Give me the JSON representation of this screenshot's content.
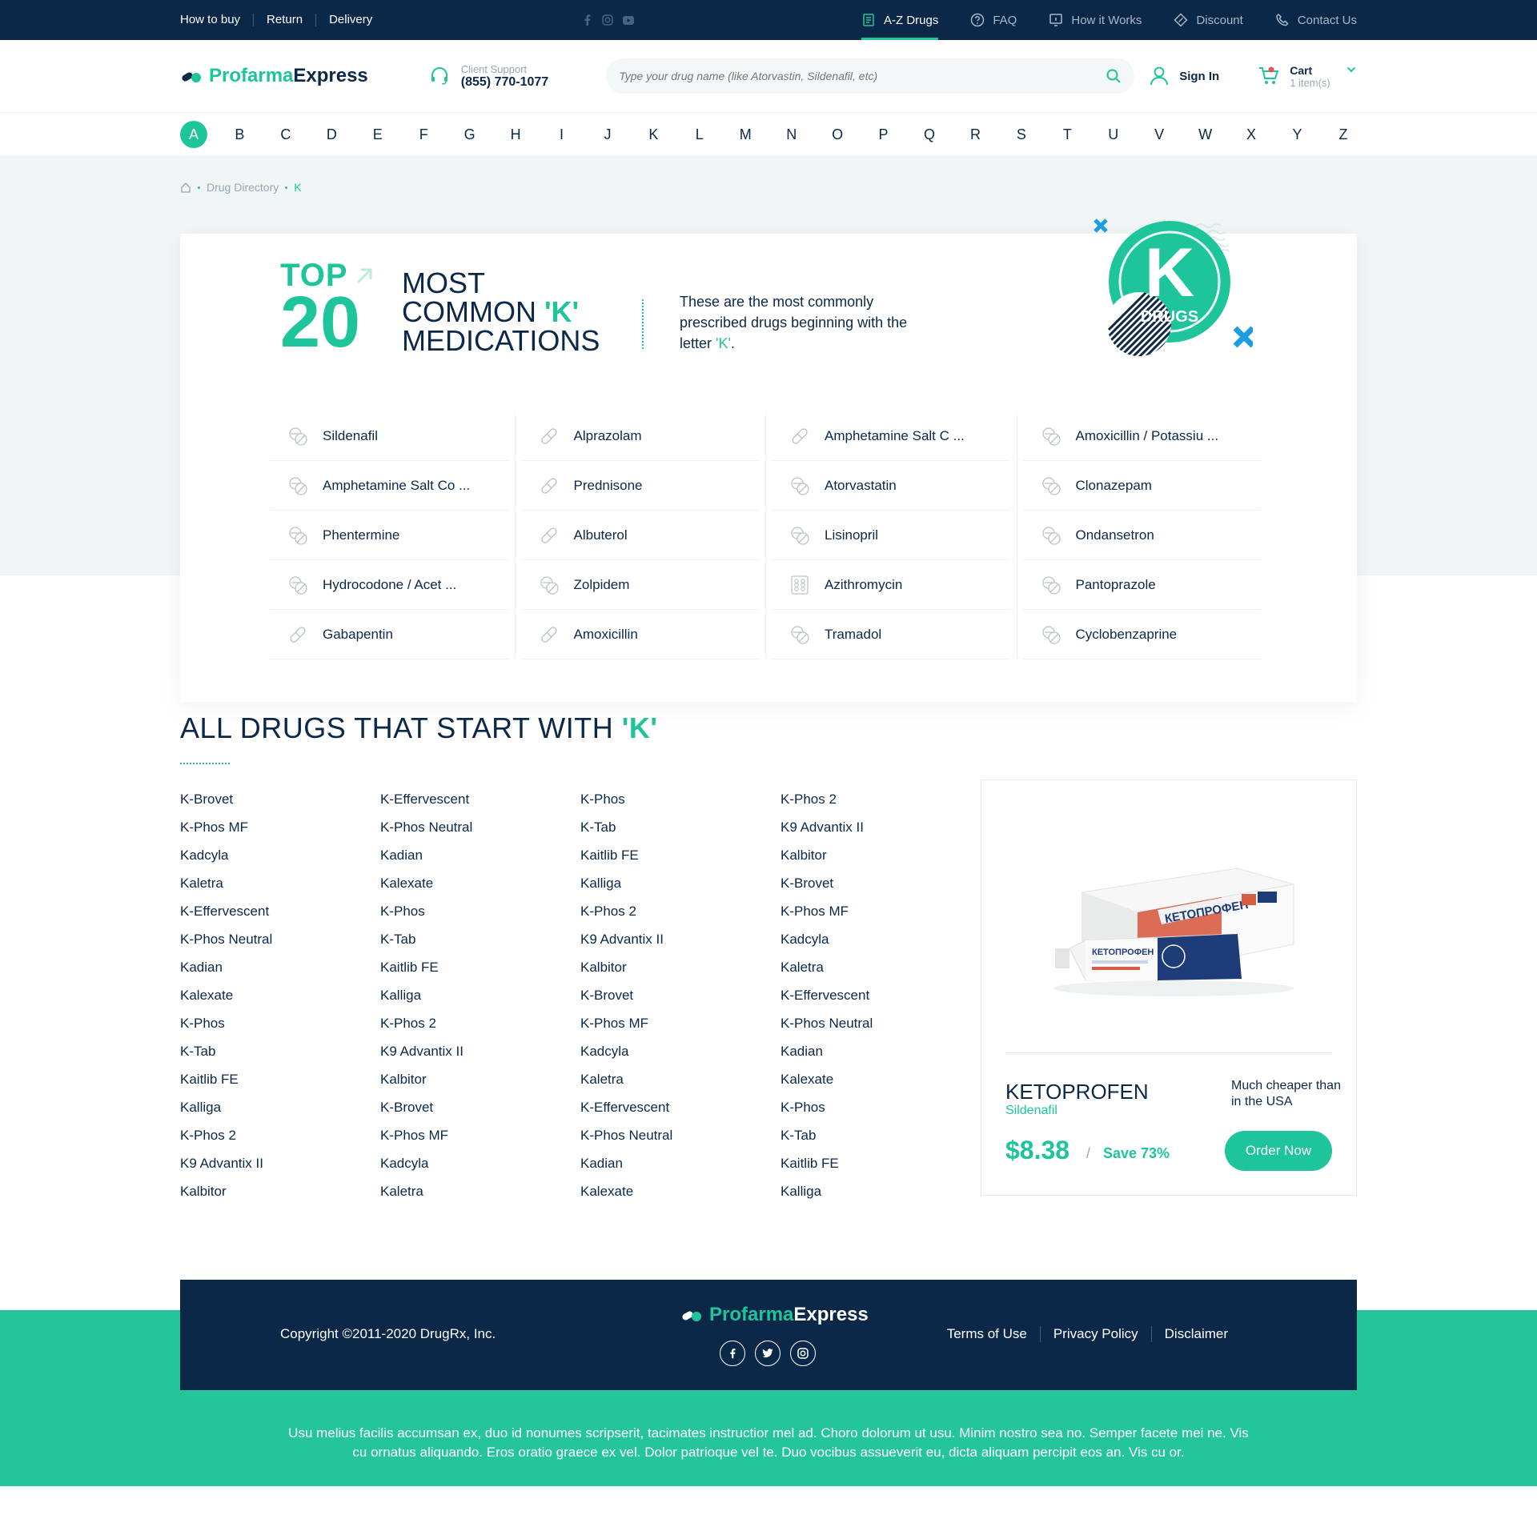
{
  "topbar": {
    "links": [
      "How to buy",
      "Return",
      "Delivery"
    ],
    "nav": [
      {
        "label": "A-Z Drugs",
        "icon": "book-icon"
      },
      {
        "label": "FAQ",
        "icon": "question-icon"
      },
      {
        "label": "How it Works",
        "icon": "info-icon"
      },
      {
        "label": "Discount",
        "icon": "discount-icon"
      },
      {
        "label": "Contact Us",
        "icon": "phone-icon"
      }
    ]
  },
  "header": {
    "logo_part1": "Profarma",
    "logo_part2": "Express",
    "support_label": "Client Support",
    "support_phone": "(855) 770-1077",
    "search_placeholder": "Type your drug name (like Atorvastin, Sildenafil, etc)",
    "signin": "Sign In",
    "cart_label": "Cart",
    "cart_items": "1 item(s)"
  },
  "alphabet": [
    "A",
    "B",
    "C",
    "D",
    "E",
    "F",
    "G",
    "H",
    "I",
    "J",
    "K",
    "L",
    "M",
    "N",
    "O",
    "P",
    "Q",
    "R",
    "S",
    "T",
    "U",
    "V",
    "W",
    "X",
    "Y",
    "Z"
  ],
  "breadcrumb": {
    "directory": "Drug Directory",
    "current": "K"
  },
  "top20": {
    "top": "TOP",
    "number": "20",
    "line1": "MOST",
    "line2": "COMMON",
    "letter": "'K'",
    "line3": "MEDICATIONS",
    "desc": "These are the most commonly prescribed drugs beginning with the letter",
    "desc_letter": "'K'",
    "desc_end": ".",
    "badge_letter": "K",
    "badge_text": "DRUGS",
    "items": [
      {
        "name": "Sildenafil",
        "icon": "pill-round-icon"
      },
      {
        "name": "Alprazolam",
        "icon": "capsule-icon"
      },
      {
        "name": "Amphetamine Salt C ...",
        "icon": "capsule-icon"
      },
      {
        "name": "Amoxicillin / Potassiu ...",
        "icon": "pill-round-icon"
      },
      {
        "name": "Amphetamine Salt Co ...",
        "icon": "pill-round-icon"
      },
      {
        "name": "Prednisone",
        "icon": "capsule-icon"
      },
      {
        "name": "Atorvastatin",
        "icon": "pill-round-icon"
      },
      {
        "name": "Clonazepam",
        "icon": "pill-round-icon"
      },
      {
        "name": "Phentermine",
        "icon": "pill-round-icon"
      },
      {
        "name": "Albuterol",
        "icon": "capsule-icon"
      },
      {
        "name": "Lisinopril",
        "icon": "pill-round-icon"
      },
      {
        "name": "Ondansetron",
        "icon": "pill-round-icon"
      },
      {
        "name": "Hydrocodone / Acet ...",
        "icon": "pill-round-icon"
      },
      {
        "name": "Zolpidem",
        "icon": "pill-round-icon"
      },
      {
        "name": "Azithromycin",
        "icon": "blister-icon"
      },
      {
        "name": "Pantoprazole",
        "icon": "pill-round-icon"
      },
      {
        "name": "Gabapentin",
        "icon": "capsule-icon"
      },
      {
        "name": "Amoxicillin",
        "icon": "capsule-icon"
      },
      {
        "name": "Tramadol",
        "icon": "pill-round-icon"
      },
      {
        "name": "Cyclobenzaprine",
        "icon": "pill-round-icon"
      }
    ]
  },
  "alldrugs": {
    "title": "ALL DRUGS THAT START WITH",
    "letter": "'K'",
    "columns": [
      [
        "K-Brovet",
        "K-Phos MF",
        "Kadcyla",
        "Kaletra",
        "K-Effervescent",
        "K-Phos Neutral",
        "Kadian",
        "Kalexate",
        "K-Phos",
        "K-Tab",
        "Kaitlib FE",
        "Kalliga",
        "K-Phos 2",
        "K9 Advantix II",
        "Kalbitor"
      ],
      [
        "K-Effervescent",
        "K-Phos Neutral",
        "Kadian",
        "Kalexate",
        "K-Phos",
        "K-Tab",
        "Kaitlib FE",
        "Kalliga",
        "K-Phos 2",
        "K9 Advantix II",
        "Kalbitor",
        "K-Brovet",
        "K-Phos MF",
        "Kadcyla",
        "Kaletra"
      ],
      [
        "K-Phos",
        "K-Tab",
        "Kaitlib FE",
        "Kalliga",
        "K-Phos 2",
        "K9 Advantix II",
        "Kalbitor",
        "K-Brovet",
        "K-Phos MF",
        "Kadcyla",
        "Kaletra",
        "K-Effervescent",
        "K-Phos Neutral",
        "Kadian",
        "Kalexate"
      ],
      [
        "K-Phos 2",
        "K9 Advantix II",
        "Kalbitor",
        "K-Brovet",
        "K-Phos MF",
        "Kadcyla",
        "Kaletra",
        "K-Effervescent",
        "K-Phos Neutral",
        "Kadian",
        "Kalexate",
        "K-Phos",
        "K-Tab",
        "Kaitlib FE",
        "Kalliga"
      ]
    ]
  },
  "promo": {
    "box_text": "КЕТОПРОФЕН",
    "name": "KETOPROFEN",
    "subtitle": "Sildenafil",
    "cheaper": "Much cheaper than in the USA",
    "price": "$8.38",
    "slash": "/",
    "save": "Save 73%",
    "button": "Order Now"
  },
  "footer": {
    "copyright": "Copyright ©2011-2020 DrugRx, Inc.",
    "logo_part1": "Profarma",
    "logo_part2": "Express",
    "links": [
      "Terms of Use",
      "Privacy Policy",
      "Disclaimer"
    ],
    "lorem": "Usu melius facilis accumsan ex, duo id nonumes scripserit, tacimates instructior mel ad. Choro dolorum ut usu. Minim nostro sea no. Semper facete mei ne. Vis cu ornatus aliquando. Eros oratio graece ex vel. Dolor patrioque vel te. Duo vocibus assueverit eu, dicta aliquam percipit eos an. Vis cu or."
  },
  "colors": {
    "accent": "#1fc59a",
    "navy": "#0b2849",
    "footer_green": "#25c59b",
    "band": "#f0f5f5"
  }
}
